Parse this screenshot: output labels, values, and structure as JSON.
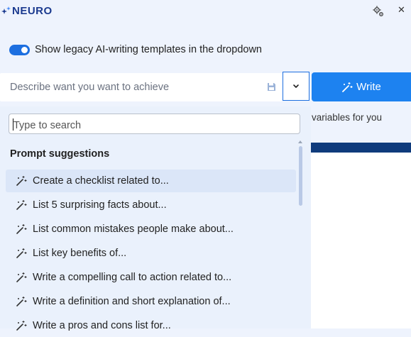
{
  "header": {
    "logo_text": "NEURO",
    "icons": {
      "settings": "settings-icon",
      "close": "close-icon"
    },
    "close_glyph": "✕"
  },
  "toggle": {
    "label": "Show legacy AI-writing templates in the dropdown",
    "on": true
  },
  "prompt": {
    "placeholder": "Describe want you want to achieve"
  },
  "write_button": {
    "label": "Write"
  },
  "background_text": "variables for you",
  "dropdown": {
    "search_placeholder": "Type to search",
    "heading": "Prompt suggestions",
    "items": [
      {
        "label": "Create a checklist related to...",
        "active": true
      },
      {
        "label": "List 5 surprising facts about..."
      },
      {
        "label": "List common mistakes people make about..."
      },
      {
        "label": "List key benefits of..."
      },
      {
        "label": "Write a compelling call to action related to..."
      },
      {
        "label": "Write a definition and short explanation of..."
      },
      {
        "label": "Write a pros and cons list for..."
      }
    ]
  },
  "colors": {
    "accent": "#1d82f0",
    "brand": "#1b3a8f",
    "panel": "#eaf1fc",
    "active_item": "#dbe6f8"
  }
}
